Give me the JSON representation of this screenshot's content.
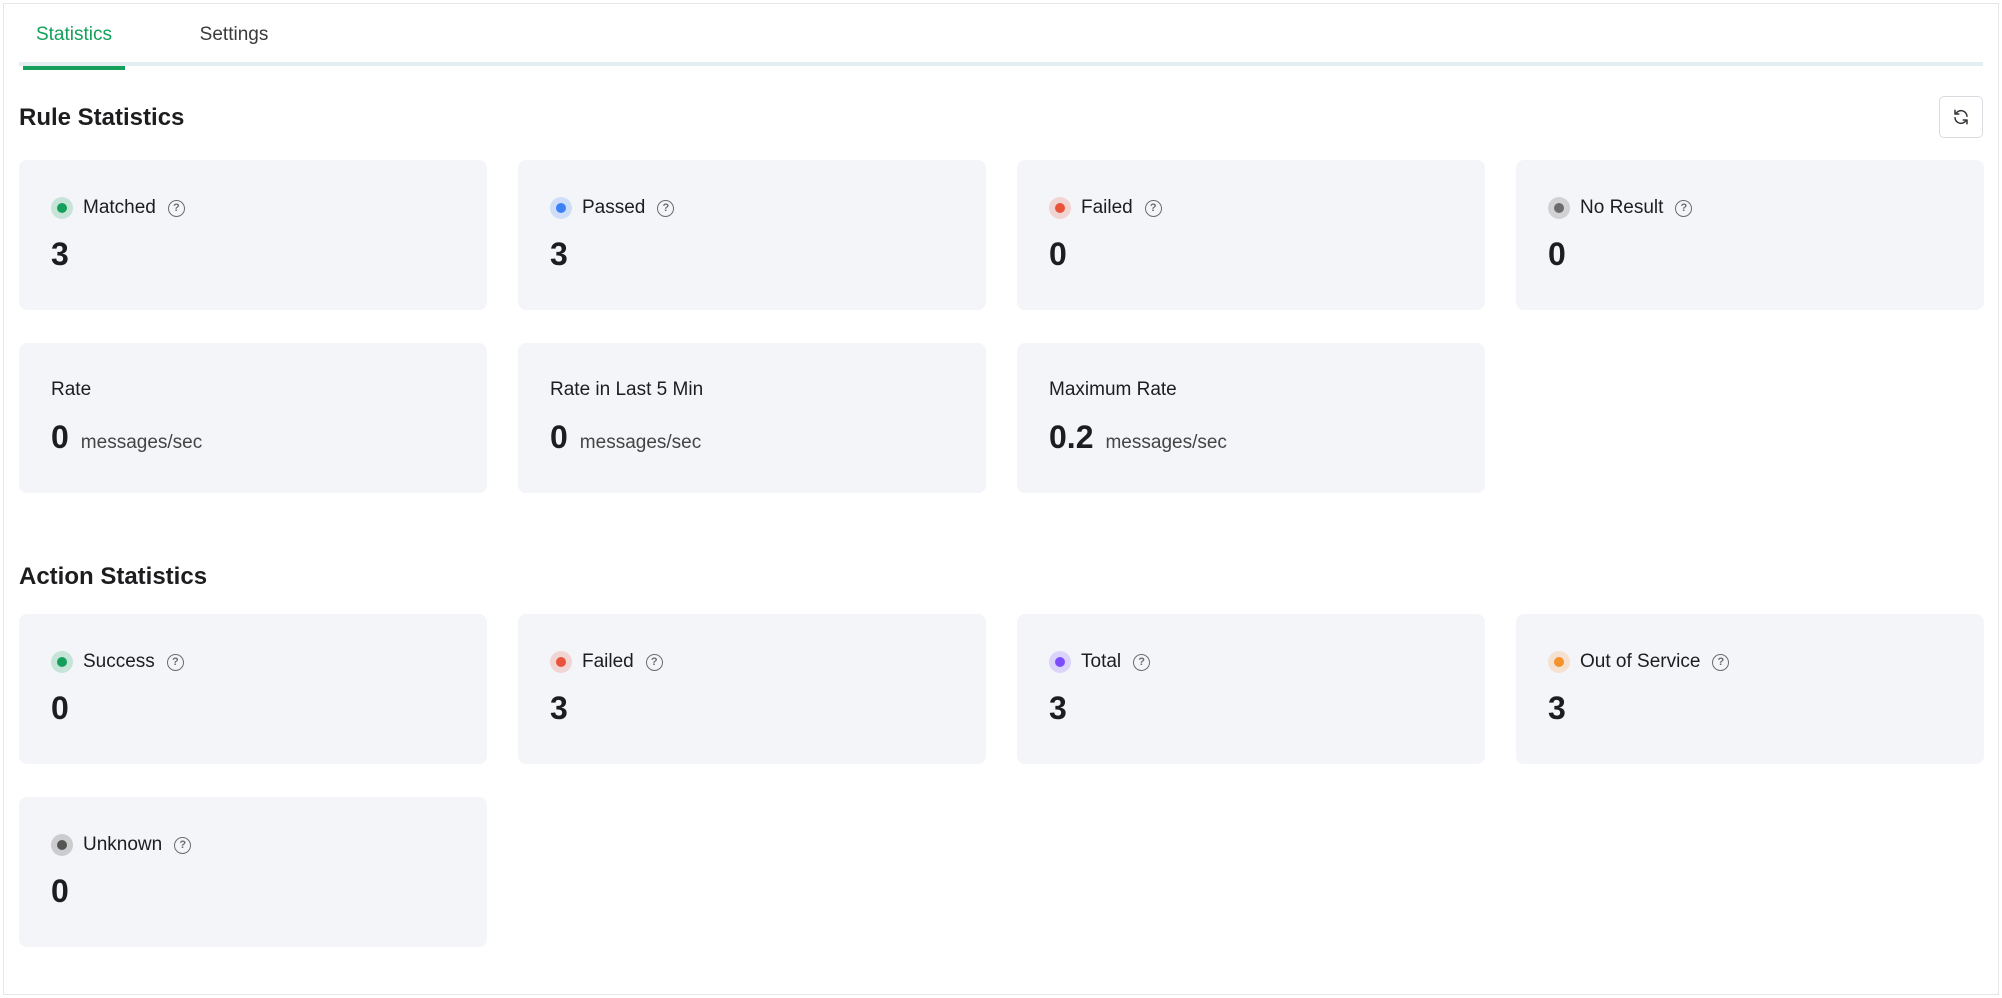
{
  "tabs": [
    {
      "label": "Statistics",
      "active": true
    },
    {
      "label": "Settings",
      "active": false
    }
  ],
  "rule_statistics": {
    "title": "Rule Statistics",
    "refresh_icon": "refresh-icon",
    "cards": [
      {
        "label": "Matched",
        "value": "3",
        "color": "#14a05a"
      },
      {
        "label": "Passed",
        "value": "3",
        "color": "#3b82f6"
      },
      {
        "label": "Failed",
        "value": "0",
        "color": "#e8533a"
      },
      {
        "label": "No Result",
        "value": "0",
        "color": "#6b6b6b"
      }
    ],
    "rates": [
      {
        "label": "Rate",
        "value": "0",
        "unit": "messages/sec"
      },
      {
        "label": "Rate in Last 5 Min",
        "value": "0",
        "unit": "messages/sec"
      },
      {
        "label": "Maximum Rate",
        "value": "0.2",
        "unit": "messages/sec"
      }
    ]
  },
  "action_statistics": {
    "title": "Action Statistics",
    "cards": [
      {
        "label": "Success",
        "value": "0",
        "color": "#14a05a"
      },
      {
        "label": "Failed",
        "value": "3",
        "color": "#e8533a"
      },
      {
        "label": "Total",
        "value": "3",
        "color": "#7b4dff"
      },
      {
        "label": "Out of Service",
        "value": "3",
        "color": "#f5922b"
      },
      {
        "label": "Unknown",
        "value": "0",
        "color": "#555555"
      }
    ]
  }
}
